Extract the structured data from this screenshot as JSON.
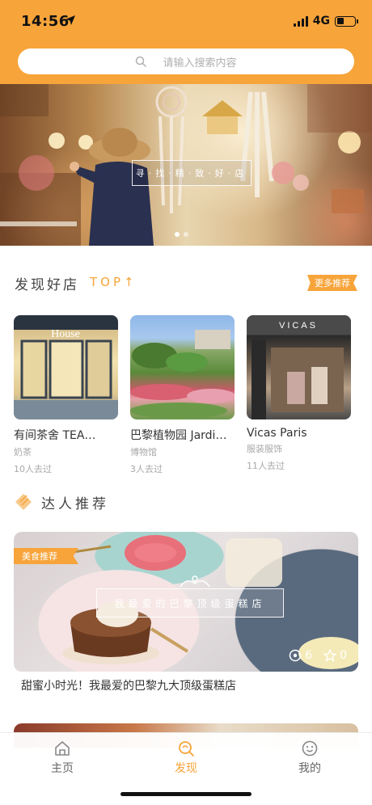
{
  "status_bar": {
    "time": "14:56",
    "network": "4G"
  },
  "search": {
    "placeholder": "请输入搜索内容",
    "icon": "search-icon"
  },
  "banner": {
    "title": "寻·找·精·致·好·店",
    "dots": 2,
    "active_dot": 1
  },
  "discover": {
    "title": "发现好店",
    "top_label": "TOP↑",
    "more_label": "更多推荐",
    "shops": [
      {
        "name": "有间茶舍 TEA…",
        "category": "奶茶",
        "visits": "10人去过",
        "sign": "House"
      },
      {
        "name": "巴黎植物园 Jardi…",
        "category": "博物馆",
        "visits": "3人去过"
      },
      {
        "name": "Vicas Paris",
        "category": "服装服饰",
        "visits": "11人去过",
        "sign": "VICAS"
      }
    ]
  },
  "talent": {
    "title": "达人推荐",
    "card": {
      "tag": "美食推荐",
      "title": "我最爱的巴黎顶级蛋糕店",
      "views": "6",
      "likes": "0",
      "caption": "甜蜜小时光！我最爱的巴黎九大顶级蛋糕店"
    }
  },
  "tabbar": {
    "items": [
      {
        "label": "主页",
        "icon": "home-icon"
      },
      {
        "label": "发现",
        "icon": "discover-icon",
        "active": true
      },
      {
        "label": "我的",
        "icon": "smiley-icon"
      }
    ]
  },
  "colors": {
    "accent": "#f7a43a",
    "text": "#333333",
    "muted": "#a8a8a8"
  }
}
